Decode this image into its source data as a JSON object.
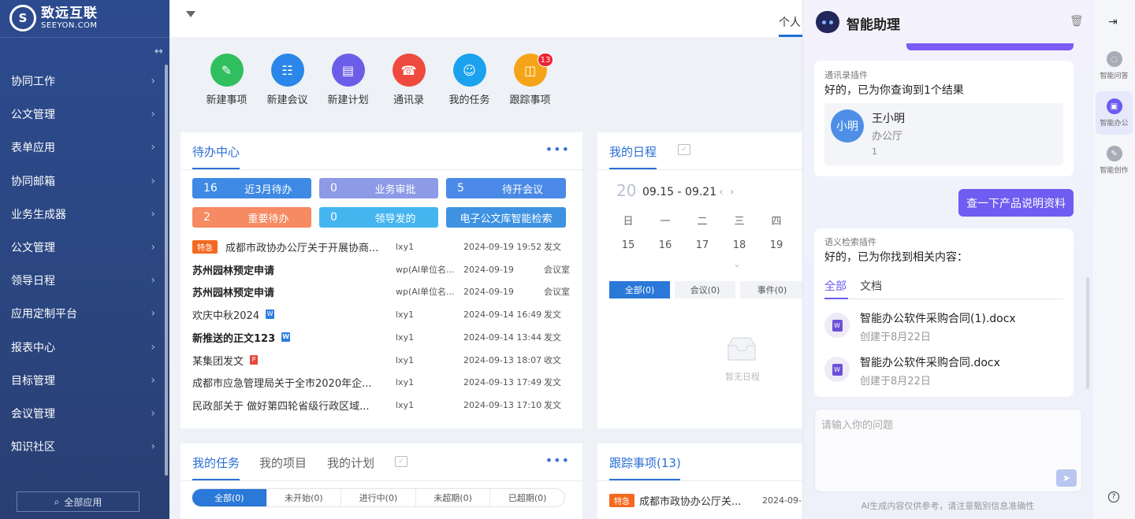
{
  "logo": {
    "cn": "致远互联",
    "en": "SEEYON.COM"
  },
  "sidebar": {
    "items": [
      {
        "label": "协同工作"
      },
      {
        "label": "公文管理"
      },
      {
        "label": "表单应用"
      },
      {
        "label": "协同邮箱"
      },
      {
        "label": "业务生成器"
      },
      {
        "label": "公文管理"
      },
      {
        "label": "领导日程"
      },
      {
        "label": "应用定制平台"
      },
      {
        "label": "报表中心"
      },
      {
        "label": "目标管理"
      },
      {
        "label": "会议管理"
      },
      {
        "label": "知识社区"
      }
    ],
    "all_apps": "全部应用"
  },
  "topbar": {
    "personal_tab": "个人"
  },
  "quick_actions": [
    {
      "label": "新建事项",
      "color": "#2fbf5f",
      "icon": "new-item-icon"
    },
    {
      "label": "新建会议",
      "color": "#2a86e8",
      "icon": "meeting-icon"
    },
    {
      "label": "新建计划",
      "color": "#6a5ee8",
      "icon": "plan-icon"
    },
    {
      "label": "通讯录",
      "color": "#ef4a3e",
      "icon": "contacts-icon"
    },
    {
      "label": "我的任务",
      "color": "#1aa2ee",
      "icon": "task-icon"
    },
    {
      "label": "跟踪事项",
      "color": "#f6a417",
      "icon": "track-icon",
      "badge": "13"
    }
  ],
  "todo": {
    "title": "待办中心",
    "pills": [
      {
        "count": "16",
        "label": "近3月待办",
        "color": "#3f8ae4"
      },
      {
        "count": "0",
        "label": "业务审批",
        "color": "#8d9ae6"
      },
      {
        "count": "5",
        "label": "待开会议",
        "color": "#4a8ae6"
      },
      {
        "count": "2",
        "label": "重要待办",
        "color": "#f68a62"
      },
      {
        "count": "0",
        "label": "领导发的",
        "color": "#45b5f0"
      },
      {
        "count": "",
        "label": "电子公文库智能检索",
        "color": "#3f92e2"
      }
    ],
    "rows": [
      {
        "tag": "特急",
        "title": "成都市政协办公厅关于开展协商...",
        "user": "lxy1",
        "date": "2024-09-19 19:52",
        "type": "发文",
        "bold": false,
        "icon": ""
      },
      {
        "tag": "",
        "title": "苏州园林预定申请",
        "user": "wp(AI单位名...",
        "date": "2024-09-19",
        "type": "会议室",
        "bold": true,
        "icon": ""
      },
      {
        "tag": "",
        "title": "苏州园林预定申请",
        "user": "wp(AI单位名...",
        "date": "2024-09-19",
        "type": "会议室",
        "bold": true,
        "icon": ""
      },
      {
        "tag": "",
        "title": "欢庆中秋2024",
        "user": "lxy1",
        "date": "2024-09-14 16:49",
        "type": "发文",
        "bold": false,
        "icon": "W"
      },
      {
        "tag": "",
        "title": "新推送的正文123",
        "user": "lxy1",
        "date": "2024-09-14 13:44",
        "type": "发文",
        "bold": true,
        "icon": "W"
      },
      {
        "tag": "",
        "title": "某集团发文",
        "user": "lxy1",
        "date": "2024-09-13 18:07",
        "type": "收文",
        "bold": false,
        "icon": "P"
      },
      {
        "tag": "",
        "title": "成都市应急管理局关于全市2020年企...",
        "user": "lxy1",
        "date": "2024-09-13 17:49",
        "type": "发文",
        "bold": false,
        "icon": ""
      },
      {
        "tag": "",
        "title": "民政部关于 做好第四轮省级行政区域...",
        "user": "lxy1",
        "date": "2024-09-13 17:10",
        "type": "发文",
        "bold": false,
        "icon": ""
      }
    ]
  },
  "schedule": {
    "title": "我的日程",
    "day": "20",
    "range": "09.15 - 09.21",
    "weekdays": [
      "日",
      "一",
      "二",
      "三",
      "四"
    ],
    "dates": [
      "15",
      "16",
      "17",
      "18",
      "19"
    ],
    "tabs": [
      "全部(0)",
      "会议(0)",
      "事件(0)"
    ],
    "empty": "暂无日程"
  },
  "tasks": {
    "tabs": [
      "我的任务",
      "我的项目",
      "我的计划"
    ],
    "segments": [
      "全部(0)",
      "未开始(0)",
      "进行中(0)",
      "未超期(0)",
      "已超期(0)"
    ]
  },
  "tracking": {
    "title": "跟踪事项(13)",
    "row": {
      "tag": "特急",
      "title": "成都市政协办公厅关...",
      "date": "2024-09-"
    }
  },
  "assistant": {
    "title": "智能助理",
    "contact_card": {
      "plugin": "通讯录插件",
      "answer": "好的，已为你查询到1个结果",
      "avatar": "小明",
      "name": "王小明",
      "dept": "办公厅",
      "num": "1"
    },
    "user_message": "查一下产品说明资料",
    "doc_card": {
      "plugin": "语义检索插件",
      "answer": "好的，已为你找到相关内容：",
      "tabs": [
        "全部",
        "文档"
      ],
      "docs": [
        {
          "name": "智能办公软件采购合同(1).docx",
          "date": "创建于8月22日"
        },
        {
          "name": "智能办公软件采购合同.docx",
          "date": "创建于8月22日"
        }
      ]
    },
    "input_placeholder": "请输入你的问题",
    "disclaimer": "AI生成内容仅供参考，请注意甄别信息准确性"
  },
  "rail": {
    "items": [
      {
        "label": "智能问答"
      },
      {
        "label": "智能办公"
      },
      {
        "label": "智能创作"
      }
    ]
  }
}
